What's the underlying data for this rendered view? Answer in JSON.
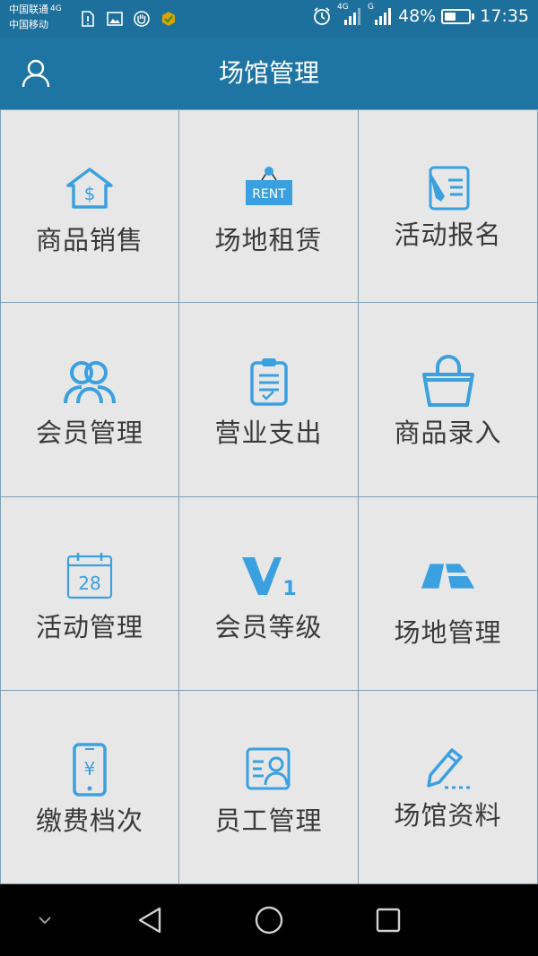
{
  "status_bar": {
    "carrier_1": "中国联通",
    "carrier_1_net": "4G",
    "carrier_2": "中国移动",
    "signal_1_label": "4G",
    "signal_2_label": "G",
    "battery_percent": "48%",
    "battery_level": 0.48,
    "time": "17:35"
  },
  "header": {
    "title": "场馆管理",
    "user_icon": "user-icon"
  },
  "tiles": [
    {
      "label": "商品销售",
      "icon": "house-dollar-icon"
    },
    {
      "label": "场地租赁",
      "icon": "rent-sign-icon"
    },
    {
      "label": "活动报名",
      "icon": "signup-pen-icon"
    },
    {
      "label": "会员管理",
      "icon": "members-icon"
    },
    {
      "label": "营业支出",
      "icon": "clipboard-check-icon"
    },
    {
      "label": "商品录入",
      "icon": "shopping-bag-icon"
    },
    {
      "label": "活动管理",
      "icon": "calendar-icon"
    },
    {
      "label": "会员等级",
      "icon": "vip-level-icon"
    },
    {
      "label": "场地管理",
      "icon": "venue-floor-icon"
    },
    {
      "label": "缴费档次",
      "icon": "phone-yuan-icon"
    },
    {
      "label": "员工管理",
      "icon": "staff-card-icon"
    },
    {
      "label": "场馆资料",
      "icon": "edit-pencil-icon"
    }
  ],
  "calendar_day": "28",
  "vip_number": "1",
  "rent_text": "RENT",
  "dollar_symbol": "$",
  "yuan_symbol": "¥",
  "colors": {
    "header": "#1e75a3",
    "status_bar": "#1d6f9c",
    "tile_bg": "#e7e7e7",
    "icon_blue": "#3ba0e0",
    "grid_line": "#7d9fb8",
    "nav_bar": "#000000"
  }
}
